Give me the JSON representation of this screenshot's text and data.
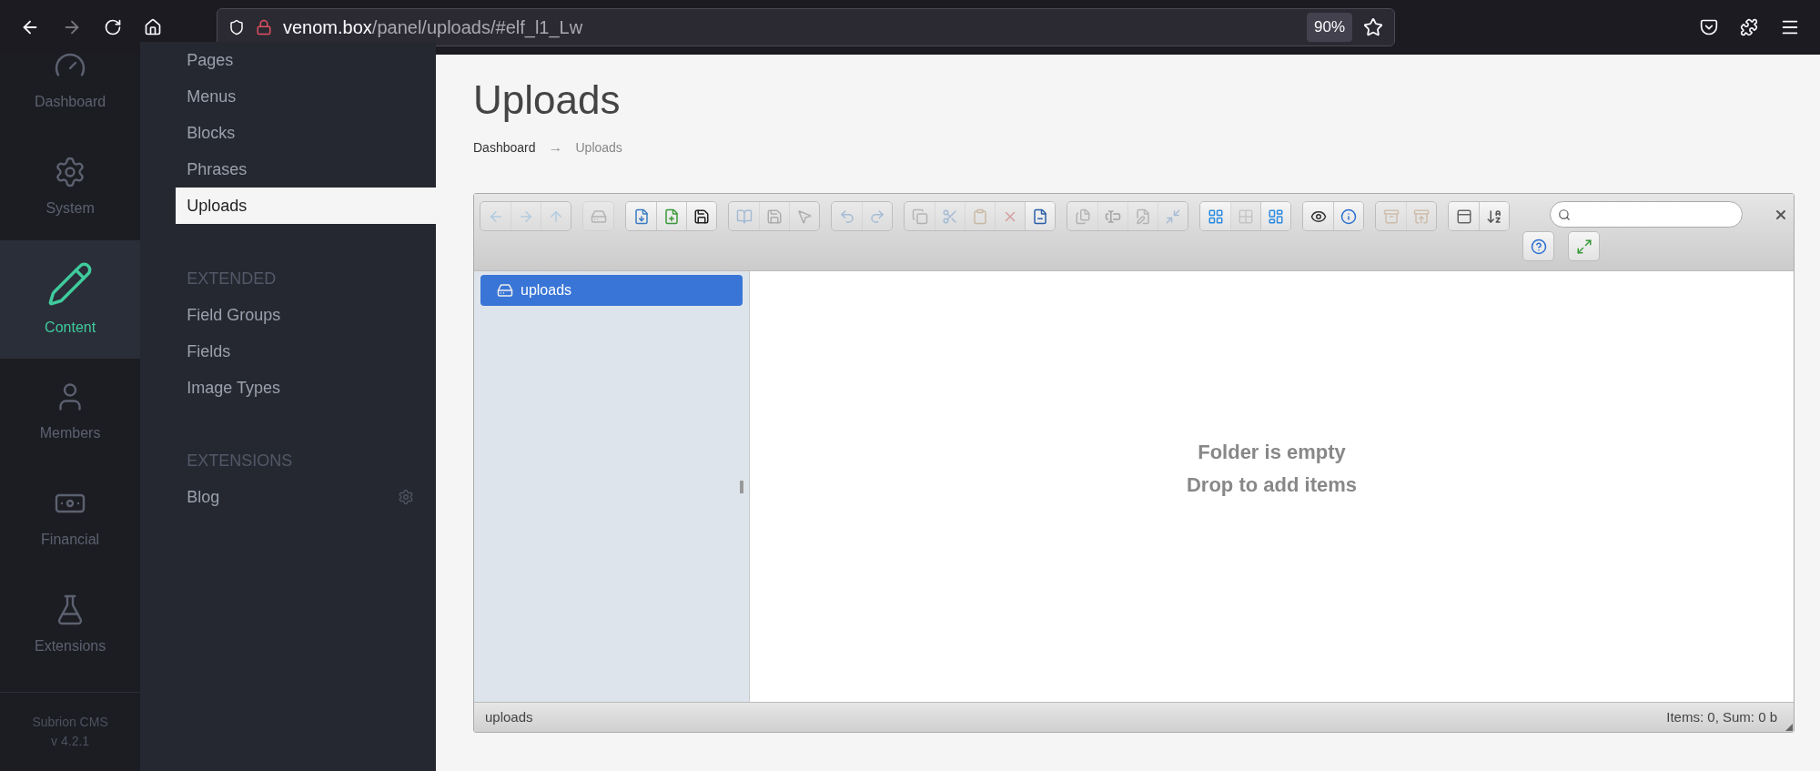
{
  "browser": {
    "url_host": "venom.box",
    "url_path": "/panel/uploads/#elf_l1_Lw",
    "zoom": "90%",
    "back_disabled": false,
    "forward_disabled": true
  },
  "rail": {
    "items": [
      {
        "label": "Dashboard",
        "selected": false
      },
      {
        "label": "System",
        "selected": false
      },
      {
        "label": "Content",
        "selected": true
      },
      {
        "label": "Members",
        "selected": false
      },
      {
        "label": "Financial",
        "selected": false
      },
      {
        "label": "Extensions",
        "selected": false
      }
    ],
    "footer": [
      "Subrion CMS",
      "v 4.2.1"
    ]
  },
  "sidebar": {
    "groups": [
      {
        "items": [
          {
            "label": "Pages",
            "selected": false,
            "settings": false
          },
          {
            "label": "Menus",
            "selected": false,
            "settings": false
          },
          {
            "label": "Blocks",
            "selected": false,
            "settings": false
          },
          {
            "label": "Phrases",
            "selected": false,
            "settings": false
          },
          {
            "label": "Uploads",
            "selected": true,
            "settings": false
          }
        ]
      },
      {
        "heading": "EXTENDED",
        "items": [
          {
            "label": "Field Groups",
            "selected": false,
            "settings": false
          },
          {
            "label": "Fields",
            "selected": false,
            "settings": false
          },
          {
            "label": "Image Types",
            "selected": false,
            "settings": false
          }
        ]
      },
      {
        "heading": "EXTENSIONS",
        "items": [
          {
            "label": "Blog",
            "selected": false,
            "settings": true
          }
        ]
      }
    ]
  },
  "page": {
    "title": "Uploads",
    "breadcrumb": [
      "Dashboard",
      "Uploads"
    ],
    "breadcrumb_separator": "→"
  },
  "finder": {
    "toolbar": {
      "groups": [
        {
          "buttons": [
            {
              "disabled": true
            },
            {
              "disabled": true
            },
            {
              "disabled": true
            }
          ]
        },
        {
          "buttons": [
            {
              "disabled": true
            }
          ]
        },
        {
          "buttons": [
            {
              "disabled": false
            },
            {
              "disabled": false
            },
            {
              "disabled": false
            }
          ]
        },
        {
          "buttons": [
            {
              "disabled": true
            },
            {
              "disabled": true
            },
            {
              "disabled": true
            }
          ]
        },
        {
          "buttons": [
            {
              "disabled": true
            },
            {
              "disabled": true
            }
          ]
        },
        {
          "buttons": [
            {
              "disabled": true
            },
            {
              "disabled": true
            },
            {
              "disabled": true
            },
            {
              "disabled": true
            },
            {
              "disabled": false
            }
          ]
        },
        {
          "buttons": [
            {
              "disabled": true
            },
            {
              "disabled": true
            },
            {
              "disabled": true
            },
            {
              "disabled": true
            }
          ]
        },
        {
          "buttons": [
            {
              "disabled": false
            },
            {
              "disabled": true
            },
            {
              "disabled": false
            }
          ]
        },
        {
          "buttons": [
            {
              "disabled": false
            },
            {
              "disabled": false
            }
          ]
        },
        {
          "buttons": [
            {
              "disabled": true
            },
            {
              "disabled": true
            }
          ]
        },
        {
          "buttons": [
            {
              "disabled": false
            },
            {
              "disabled": false
            }
          ]
        }
      ],
      "second_row": [
        {
          "disabled": false
        },
        {
          "disabled": false
        }
      ]
    },
    "tree": [
      {
        "label": "uploads",
        "selected": true
      }
    ],
    "empty_lines": [
      "Folder is empty",
      "Drop to add items"
    ],
    "status_left": "uploads",
    "status_right": "Items: 0, Sum: 0 b"
  }
}
